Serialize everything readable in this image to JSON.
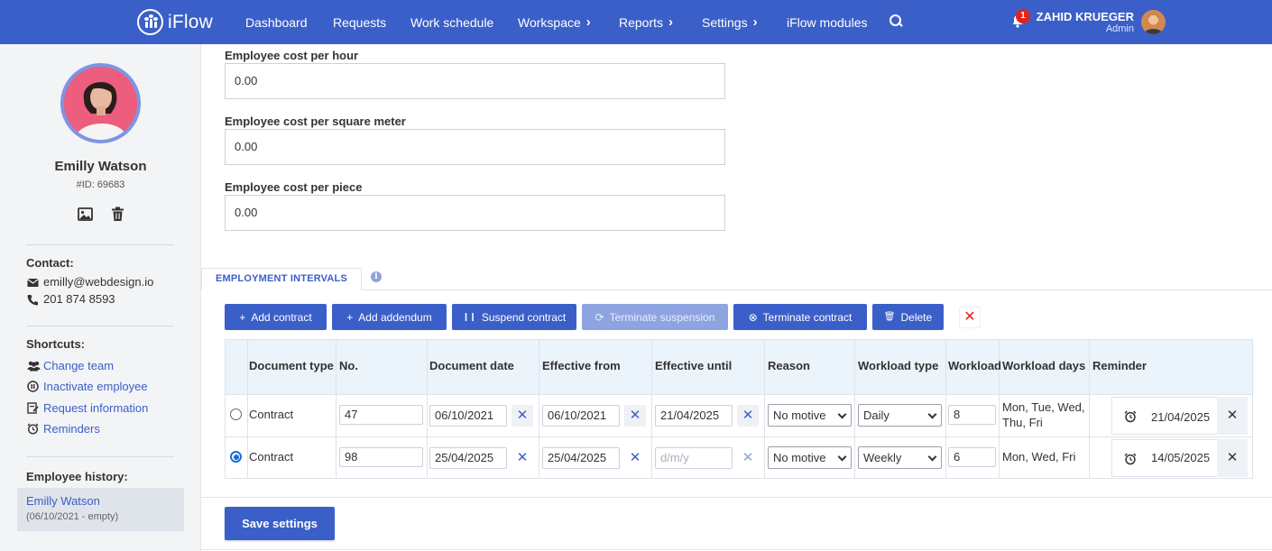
{
  "app": {
    "name": "iFlow",
    "brand_color": "#3b5fc8"
  },
  "nav": {
    "items": [
      {
        "label": "Dashboard",
        "has_chevron": false
      },
      {
        "label": "Requests",
        "has_chevron": false
      },
      {
        "label": "Work schedule",
        "has_chevron": false
      },
      {
        "label": "Workspace",
        "has_chevron": true
      },
      {
        "label": "Reports",
        "has_chevron": true
      },
      {
        "label": "Settings",
        "has_chevron": true
      },
      {
        "label": "iFlow modules",
        "has_chevron": false
      }
    ],
    "chevron": "›",
    "notification_count": "1"
  },
  "user": {
    "name": "ZAHID KRUEGER",
    "role": "Admin"
  },
  "sidebar": {
    "employee_name": "Emilly Watson",
    "employee_id": "#ID: 69683",
    "contact_label": "Contact:",
    "email": "emilly@webdesign.io",
    "phone": "201 874 8593",
    "shortcuts_label": "Shortcuts:",
    "shortcuts": [
      {
        "label": "Change team",
        "icon": "users-icon"
      },
      {
        "label": "Inactivate employee",
        "icon": "inactivate-icon"
      },
      {
        "label": "Request information",
        "icon": "request-info-icon"
      },
      {
        "label": "Reminders",
        "icon": "alarm-clock-icon"
      }
    ],
    "history_label": "Employee history:",
    "history_name": "Emilly Watson",
    "history_range": "(06/10/2021 - empty)"
  },
  "fields": [
    {
      "label": "Employee cost per hour",
      "value": "0.00"
    },
    {
      "label": "Employee cost per square meter",
      "value": "0.00"
    },
    {
      "label": "Employee cost per piece",
      "value": "0.00"
    }
  ],
  "tab": {
    "label": "EMPLOYMENT INTERVALS",
    "info_glyph": "i"
  },
  "actions": [
    {
      "label": "Add contract",
      "icon": "+",
      "disabled": false
    },
    {
      "label": "Add addendum",
      "icon": "+",
      "disabled": false
    },
    {
      "label": "Suspend contract",
      "icon": "❙❙",
      "disabled": false
    },
    {
      "label": "Terminate suspension",
      "icon": "⟳",
      "disabled": true
    },
    {
      "label": "Terminate contract",
      "icon": "⊗",
      "disabled": false
    },
    {
      "label": "Delete",
      "icon": "🗑",
      "disabled": false
    }
  ],
  "clear_glyph": "✕",
  "table": {
    "headers": [
      "Document type",
      "No.",
      "Document date",
      "Effective from",
      "Effective until",
      "Reason",
      "Workload type",
      "Workload",
      "Workload days",
      "Reminder"
    ],
    "rows": [
      {
        "selected": false,
        "document_type": "Contract",
        "no": "47",
        "document_date": "06/10/2021",
        "effective_from": "06/10/2021",
        "effective_until": "21/04/2025",
        "effective_until_placeholder": "",
        "reason": "No motive",
        "workload_type": "Daily",
        "workload": "8",
        "workload_days_line1": "Mon, Tue, Wed,",
        "workload_days_line2": "Thu, Fri",
        "reminder": "21/04/2025"
      },
      {
        "selected": true,
        "document_type": "Contract",
        "no": "98",
        "document_date": "25/04/2025",
        "effective_from": "25/04/2025",
        "effective_until": "",
        "effective_until_placeholder": "d/m/y",
        "reason": "No motive",
        "workload_type": "Weekly",
        "workload": "6",
        "workload_days_line1": "Mon, Wed, Fri",
        "workload_days_line2": "",
        "reminder": "14/05/2025"
      }
    ]
  },
  "save_label": "Save settings"
}
